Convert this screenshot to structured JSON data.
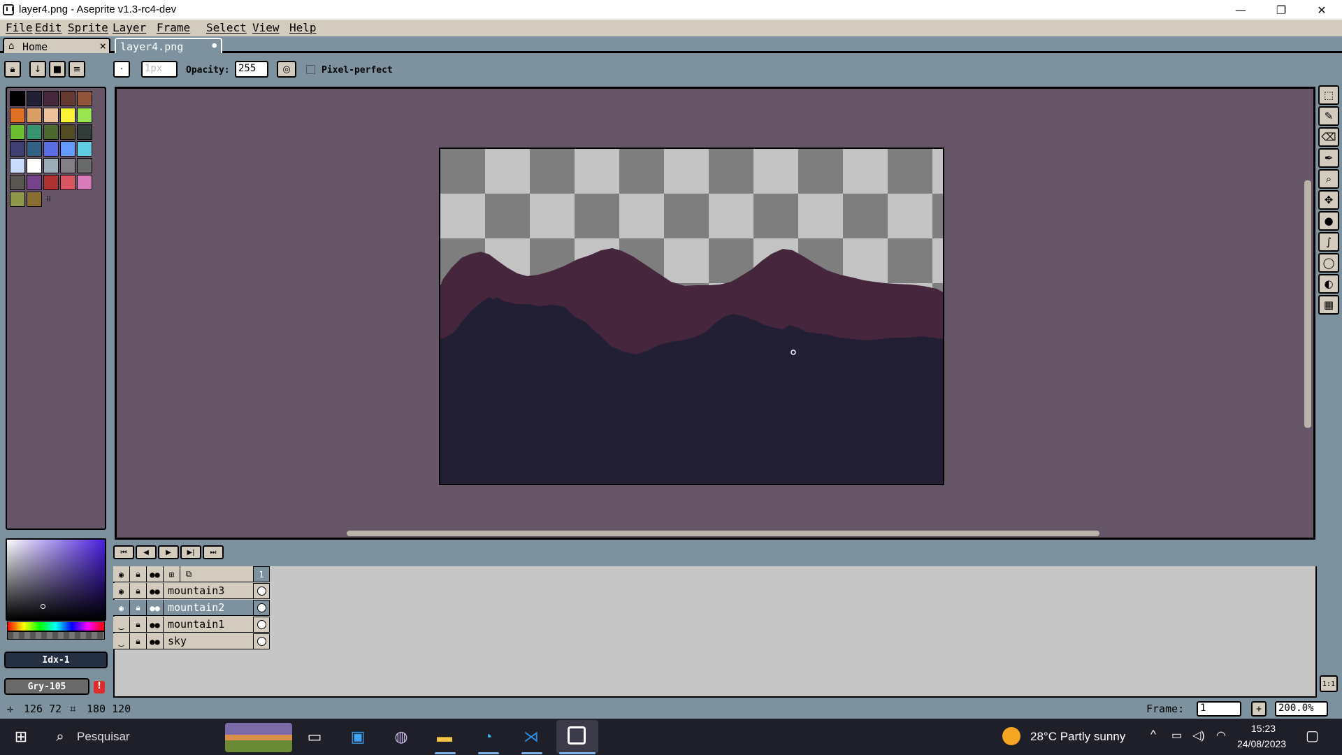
{
  "window": {
    "title": "layer4.png - Aseprite v1.3-rc4-dev",
    "minimize": "—",
    "maximize": "❐",
    "close": "✕"
  },
  "menu": [
    "File",
    "Edit",
    "Sprite",
    "Layer",
    "Frame",
    "Select",
    "View",
    "Help"
  ],
  "tabs": {
    "home_label": "Home",
    "home_close": "×",
    "file_label": "layer4.png",
    "file_modified": "●"
  },
  "tool_options": {
    "brush_size": "1px",
    "opacity_label": "Opacity:",
    "opacity_value": "255",
    "pixel_perfect_label": "Pixel-perfect"
  },
  "palette": {
    "colors": [
      "#000000",
      "#222034",
      "#45283c",
      "#663931",
      "#8f563b",
      "#df7126",
      "#d9a066",
      "#eec39a",
      "#fbf236",
      "#99e550",
      "#6abe30",
      "#37946e",
      "#4b692f",
      "#524b24",
      "#323c39",
      "#3f3f74",
      "#306082",
      "#5b6ee1",
      "#639bff",
      "#5fcde4",
      "#cbdbfc",
      "#ffffff",
      "#9badb7",
      "#847e87",
      "#696a6a",
      "#595652",
      "#76428a",
      "#ac3232",
      "#d95763",
      "#d77bba",
      "#8f974a",
      "#8a6f30"
    ]
  },
  "color_panel": {
    "index_label": "Idx-1",
    "color_label": "Gry-105",
    "warning": "!"
  },
  "timeline": {
    "frame_number": "1",
    "layers": [
      {
        "name": "mountain3",
        "visible": true,
        "selected": false
      },
      {
        "name": "mountain2",
        "visible": true,
        "selected": true
      },
      {
        "name": "mountain1",
        "visible": false,
        "selected": false
      },
      {
        "name": "sky",
        "visible": false,
        "selected": false
      }
    ]
  },
  "status": {
    "cursor_pos": "126  72",
    "sprite_size": "180  120",
    "frame_label": "Frame:",
    "frame_value": "1",
    "zoom_value": "200.0%",
    "ratio_label": "1:1"
  },
  "taskbar": {
    "search_placeholder": "Pesquisar",
    "weather": "28°C  Partly sunny",
    "time": "15:23",
    "date": "24/08/2023"
  },
  "colors": {
    "ui_bg": "#7d929e",
    "ui_panel": "#d3cbbe",
    "editor_bg": "#655566",
    "mountain_far": "#45263d",
    "mountain_near": "#221f35"
  }
}
